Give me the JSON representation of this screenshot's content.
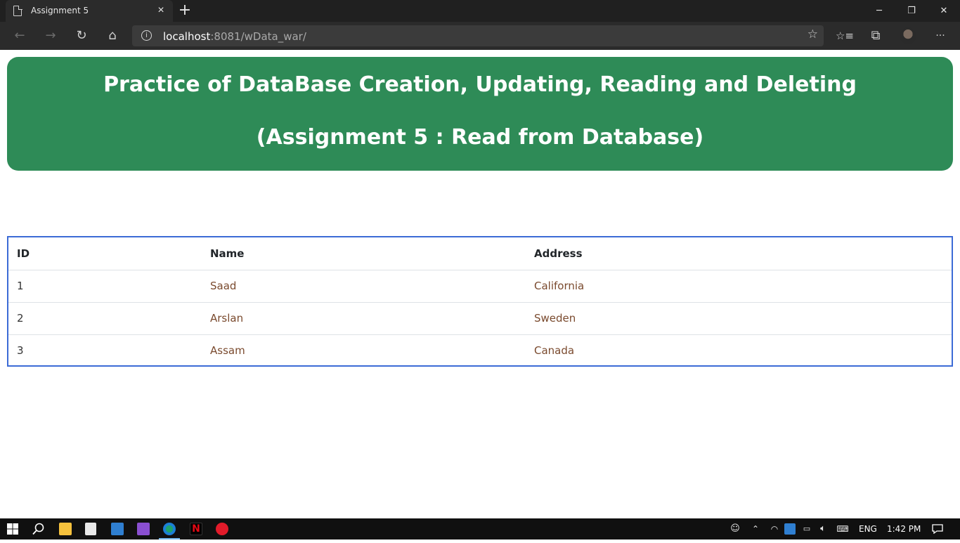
{
  "browser": {
    "tab_title": "Assignment 5",
    "tab_close": "×",
    "new_tab": "+",
    "url_host": "localhost",
    "url_rest": ":8081/wData_war/",
    "window_controls": {
      "minimize": "─",
      "restore": "❐",
      "close": "✕"
    },
    "nav": {
      "back": "←",
      "forward": "→",
      "refresh": "↻",
      "home": "⌂"
    },
    "toolbar_icons": {
      "favorites": "☆",
      "favorites_bar": "☆≡",
      "collections": "⧉",
      "more": "···"
    }
  },
  "page": {
    "heading_line1": "Practice of DataBase Creation, Updating, Reading and Deleting",
    "heading_line2": "(Assignment 5 : Read from Database)",
    "accent_color": "#2e8b57",
    "table": {
      "headers": [
        "ID",
        "Name",
        "Address"
      ],
      "rows": [
        [
          "1",
          "Saad",
          "California"
        ],
        [
          "2",
          "Arslan",
          "Sweden"
        ],
        [
          "3",
          "Assam",
          "Canada"
        ]
      ]
    }
  },
  "taskbar": {
    "language": "ENG",
    "time": "1:42 PM",
    "apps": [
      "windows-start",
      "search",
      "file-explorer",
      "store",
      "mail",
      "visual-studio",
      "edge",
      "netflix",
      "opera"
    ]
  }
}
